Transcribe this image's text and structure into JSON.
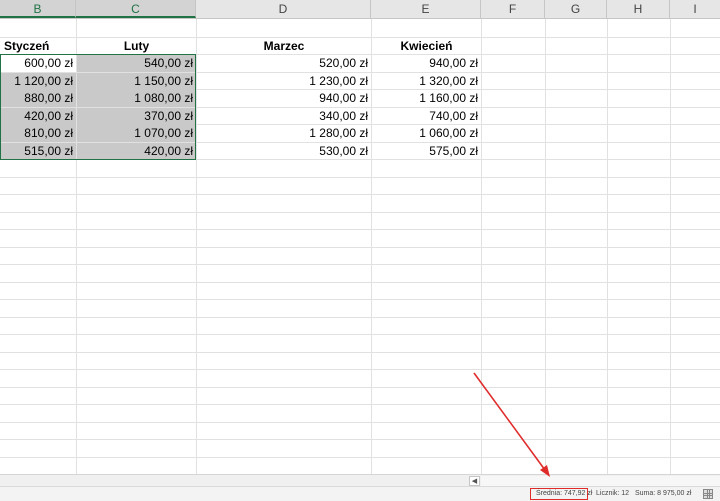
{
  "columns": [
    "B",
    "C",
    "D",
    "E",
    "F",
    "G",
    "H",
    "I"
  ],
  "selected_column": "C",
  "table": {
    "headers": [
      "Styczeń",
      "Luty",
      "Marzec",
      "Kwiecień"
    ],
    "rows": [
      [
        "600,00 zł",
        "540,00 zł",
        "520,00 zł",
        "940,00 zł"
      ],
      [
        "1 120,00 zł",
        "1 150,00 zł",
        "1 230,00 zł",
        "1 320,00 zł"
      ],
      [
        "880,00 zł",
        "1 080,00 zł",
        "940,00 zł",
        "1 160,00 zł"
      ],
      [
        "420,00 zł",
        "370,00 zł",
        "340,00 zł",
        "740,00 zł"
      ],
      [
        "810,00 zł",
        "1 070,00 zł",
        "1 280,00 zł",
        "1 060,00 zł"
      ],
      [
        "515,00 zł",
        "420,00 zł",
        "530,00 zł",
        "575,00 zł"
      ]
    ]
  },
  "status_bar": {
    "average": "Średnia: 747,92 zł",
    "count": "Licznik: 12",
    "sum": "Suma: 8 975,00 zł"
  },
  "icons": {
    "scroll_left": "triangle-left-icon",
    "view_normal": "grid-view-icon"
  },
  "colors": {
    "selection_border": "#217346",
    "selection_fill": "#c9c9c9",
    "annotation": "#e02b2b"
  }
}
